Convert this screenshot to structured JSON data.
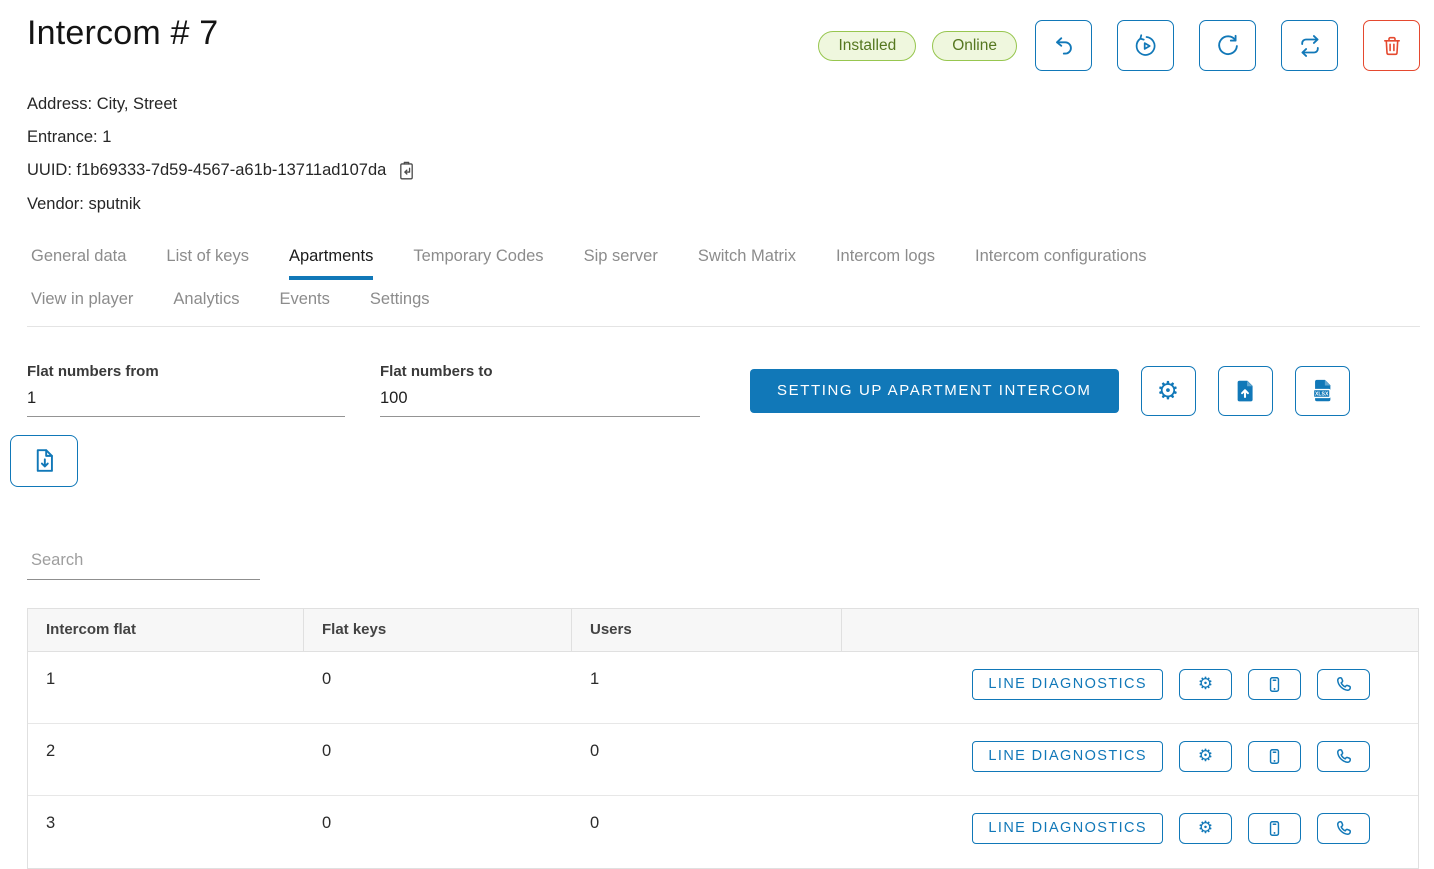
{
  "header": {
    "title": "Intercom # 7",
    "badges": [
      {
        "label": "Installed"
      },
      {
        "label": "Online"
      }
    ],
    "info": {
      "address": "Address: City, Street",
      "entrance": "Entrance: 1",
      "uuid": "UUID: f1b69333-7d59-4567-a61b-13711ad107da",
      "vendor": "Vendor: sputnik"
    },
    "action_icons": [
      "undo-icon",
      "history-restore-icon",
      "refresh-icon",
      "sync-icon",
      "trash-icon"
    ]
  },
  "tabs": {
    "row1": [
      "General data",
      "List of keys",
      "Apartments",
      "Temporary Codes",
      "Sip server",
      "Switch Matrix",
      "Intercom logs",
      "Intercom configurations"
    ],
    "row2": [
      "View in player",
      "Analytics",
      "Events",
      "Settings"
    ],
    "active": "Apartments"
  },
  "form": {
    "flat_from": {
      "label": "Flat numbers from",
      "value": "1"
    },
    "flat_to": {
      "label": "Flat numbers to",
      "value": "100"
    },
    "setup_button": "SETTING UP APARTMENT INTERCOM",
    "icon_buttons": [
      "gear-icon",
      "file-upload-icon",
      "file-xlsx-icon",
      "file-download-icon"
    ]
  },
  "search": {
    "placeholder": "Search"
  },
  "table": {
    "columns": [
      "Intercom flat",
      "Flat keys",
      "Users"
    ],
    "rows": [
      {
        "flat": "1",
        "keys": "0",
        "users": "1",
        "diagnostics": "LINE DIAGNOSTICS"
      },
      {
        "flat": "2",
        "keys": "0",
        "users": "0",
        "diagnostics": "LINE DIAGNOSTICS"
      },
      {
        "flat": "3",
        "keys": "0",
        "users": "0",
        "diagnostics": "LINE DIAGNOSTICS"
      }
    ],
    "row_icons": [
      "gear-icon",
      "smartphone-icon",
      "phone-icon"
    ]
  },
  "icons": {
    "settings_glyph": "⚙"
  },
  "colors": {
    "primary": "#1178b8",
    "danger": "#e5492f",
    "badge_bg": "#eff7de",
    "badge_border": "#97c64f",
    "badge_text": "#55771f",
    "tab_inactive": "#8c8c8c",
    "table_border": "#e0e0e0",
    "header_bg": "#f7f7f7"
  }
}
